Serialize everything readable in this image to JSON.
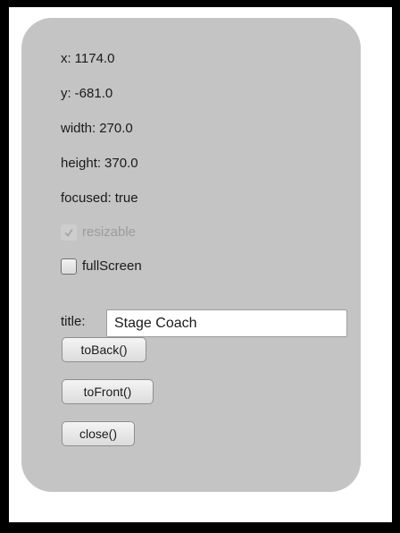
{
  "stage": {
    "x": {
      "label": "x:",
      "value": "1174.0"
    },
    "y": {
      "label": "y:",
      "value": "-681.0"
    },
    "width": {
      "label": "width:",
      "value": "270.0"
    },
    "height": {
      "label": "height:",
      "value": "370.0"
    },
    "focused": {
      "label": "focused:",
      "value": "true"
    }
  },
  "controls": {
    "resizable": {
      "label": "resizable",
      "checked": true,
      "enabled": false
    },
    "fullscreen": {
      "label": "fullScreen",
      "checked": false,
      "enabled": true
    },
    "title": {
      "label": "title:",
      "value": "Stage Coach"
    }
  },
  "buttons": {
    "to_back": "toBack()",
    "to_front": "toFront()",
    "close": "close()"
  },
  "colors": {
    "stage_background": "#c4c4c4",
    "outer_background": "#000000",
    "window_background": "#ffffff",
    "disabled_text": "#9c9c9c"
  }
}
